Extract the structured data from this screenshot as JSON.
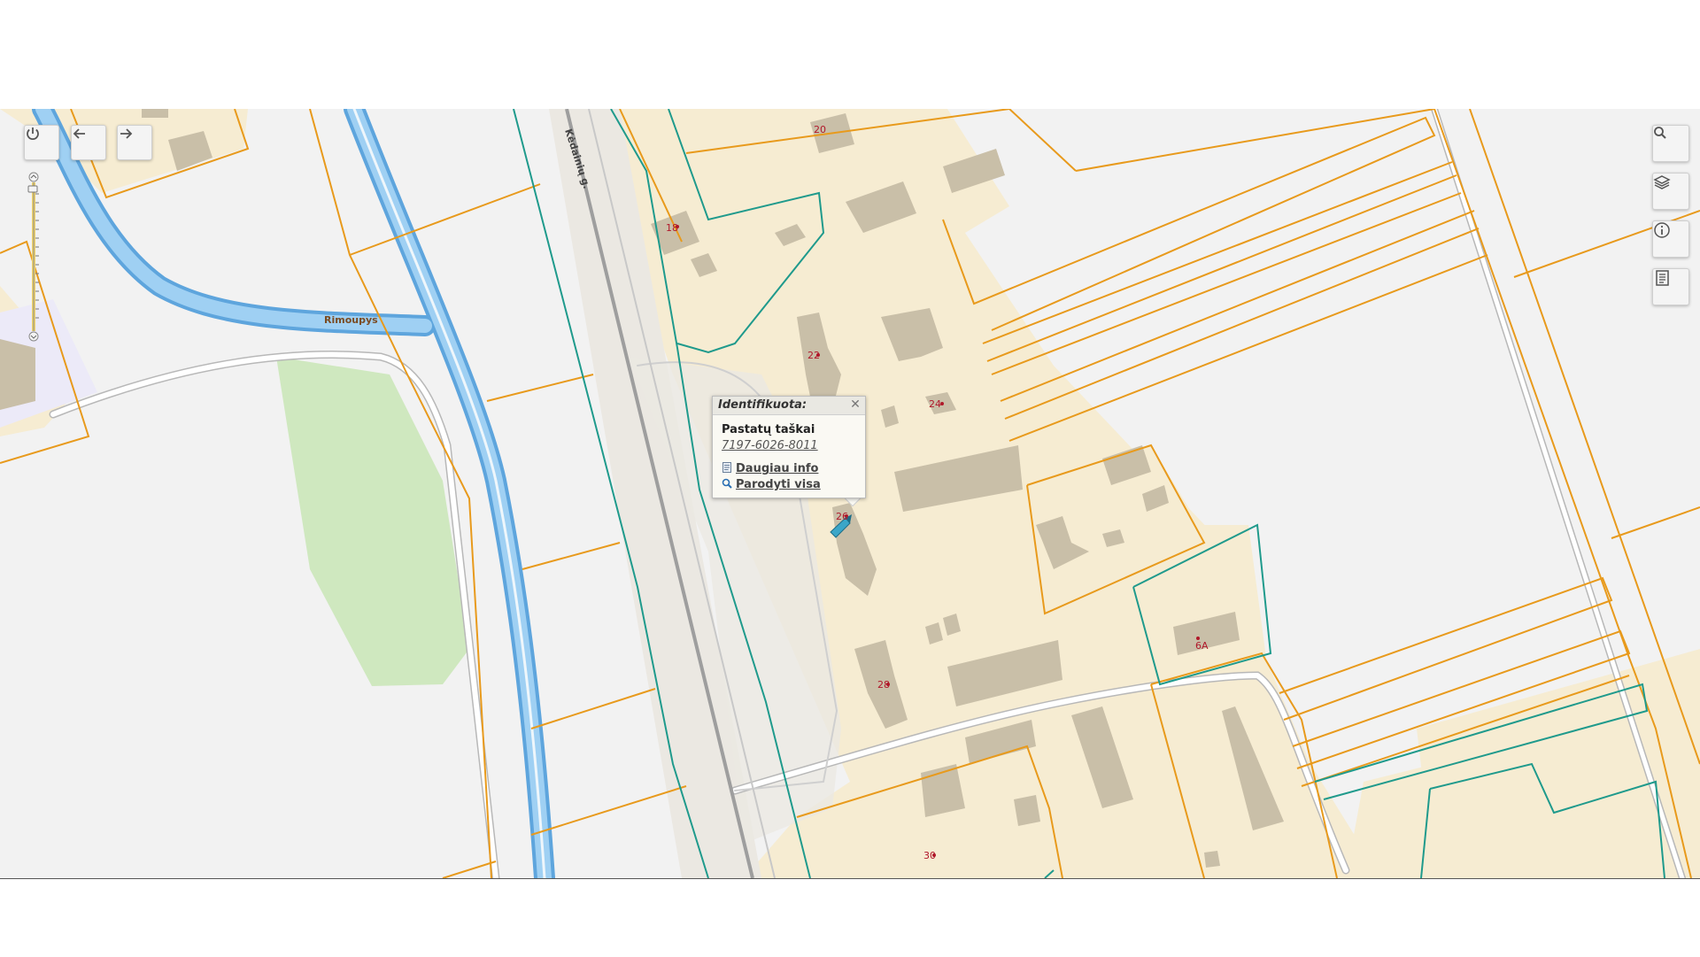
{
  "map": {
    "street_label": "Kėdainių g.",
    "river_label": "Rimoupys",
    "house_numbers": [
      "20",
      "18",
      "22",
      "24",
      "26",
      "28",
      "30",
      "6A"
    ],
    "colors": {
      "background": "#f2f2f2",
      "built_area": "#f6ecd2",
      "building": "#c9bfa8",
      "parcel_orange": "#e89a1c",
      "parcel_teal": "#1f9a8c",
      "river": "#8fc5ee",
      "park": "#cfe8bf",
      "road": "#ffffff",
      "railway": "#a7a7a7"
    }
  },
  "controls": {
    "power_icon": "power-icon",
    "back_icon": "arrow-left-icon",
    "forward_icon": "arrow-right-icon",
    "search_icon": "search-icon",
    "layers_icon": "layers-icon",
    "info_icon": "info-icon",
    "legend_icon": "document-icon"
  },
  "popup": {
    "header": "Identifikuota:",
    "title": "Pastatų taškai",
    "id": "7197-6026-8011",
    "more_info": "Daugiau info",
    "show_all": "Parodyti visa"
  }
}
